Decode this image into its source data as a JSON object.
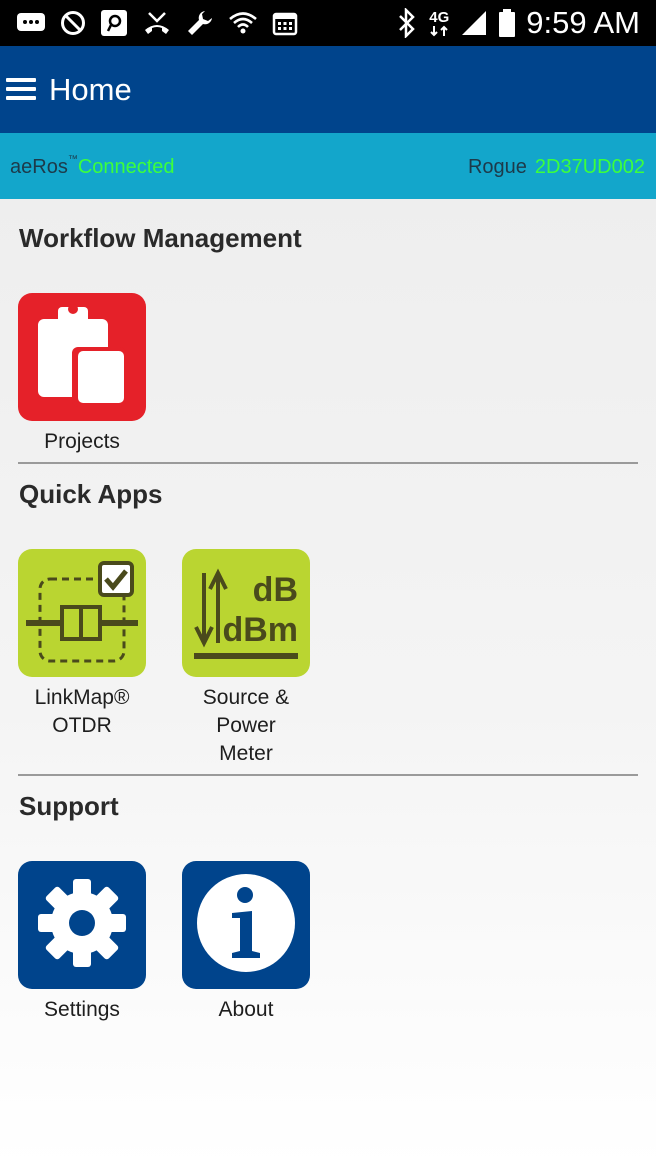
{
  "status_bar": {
    "time": "9:59 AM",
    "network_label": "4G",
    "icons_left": [
      "messages-icon",
      "do-not-disturb-icon",
      "app-notification-icon",
      "missed-call-icon",
      "wrench-icon",
      "wifi-icon",
      "calendar-icon"
    ],
    "icons_right": [
      "bluetooth-icon",
      "network-4g-icon",
      "signal-icon",
      "battery-icon"
    ]
  },
  "app_bar": {
    "title": "Home",
    "menu_icon": "hamburger-menu-icon"
  },
  "connection": {
    "app_name": "aeRos",
    "trademark": "™",
    "status": "Connected",
    "device_label": "Rogue",
    "device_serial": "2D37UD002",
    "colors": {
      "background": "#13a6cb",
      "status": "#3cff3c"
    }
  },
  "sections": {
    "workflow": {
      "title": "Workflow Management",
      "tiles": [
        {
          "label": "Projects",
          "icon": "clipboard-icon",
          "color": "#e52129"
        }
      ]
    },
    "quick_apps": {
      "title": "Quick Apps",
      "tiles": [
        {
          "label": "LinkMap®\nOTDR",
          "icon": "linkmap-otdr-icon",
          "color": "#bad531"
        },
        {
          "label": "Source &\nPower\nMeter",
          "icon": "db-dbm-icon",
          "color": "#bad531",
          "icon_text_top": "dB",
          "icon_text_bottom": "dBm"
        }
      ]
    },
    "support": {
      "title": "Support",
      "tiles": [
        {
          "label": "Settings",
          "icon": "gear-icon",
          "color": "#00448c"
        },
        {
          "label": "About",
          "icon": "info-icon",
          "color": "#00448c"
        }
      ]
    }
  }
}
